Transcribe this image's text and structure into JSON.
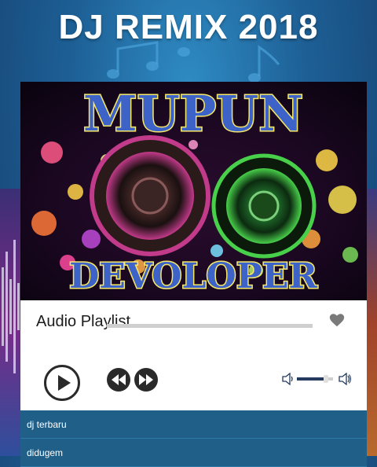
{
  "app": {
    "title": "DJ REMIX 2018"
  },
  "cover": {
    "line1": "MUPUN",
    "line2": "DEVOLOPER",
    "colors": {
      "text": "#3e63c8",
      "outline": "#f6e96a"
    }
  },
  "player": {
    "playlist_title": "Audio Playlist",
    "favorite_icon": "heart-icon",
    "controls": {
      "play_icon": "play-icon",
      "prev_icon": "rewind-icon",
      "next_icon": "fast-forward-icon",
      "volume_low_icon": "volume-low-icon",
      "volume_high_icon": "volume-high-icon"
    },
    "seek_progress": 0,
    "volume_level": 0.8
  },
  "tracks": [
    {
      "title": "dj terbaru"
    },
    {
      "title": "didugem"
    }
  ],
  "colors": {
    "accent": "#1f5f88",
    "background": "#1d5f95"
  }
}
